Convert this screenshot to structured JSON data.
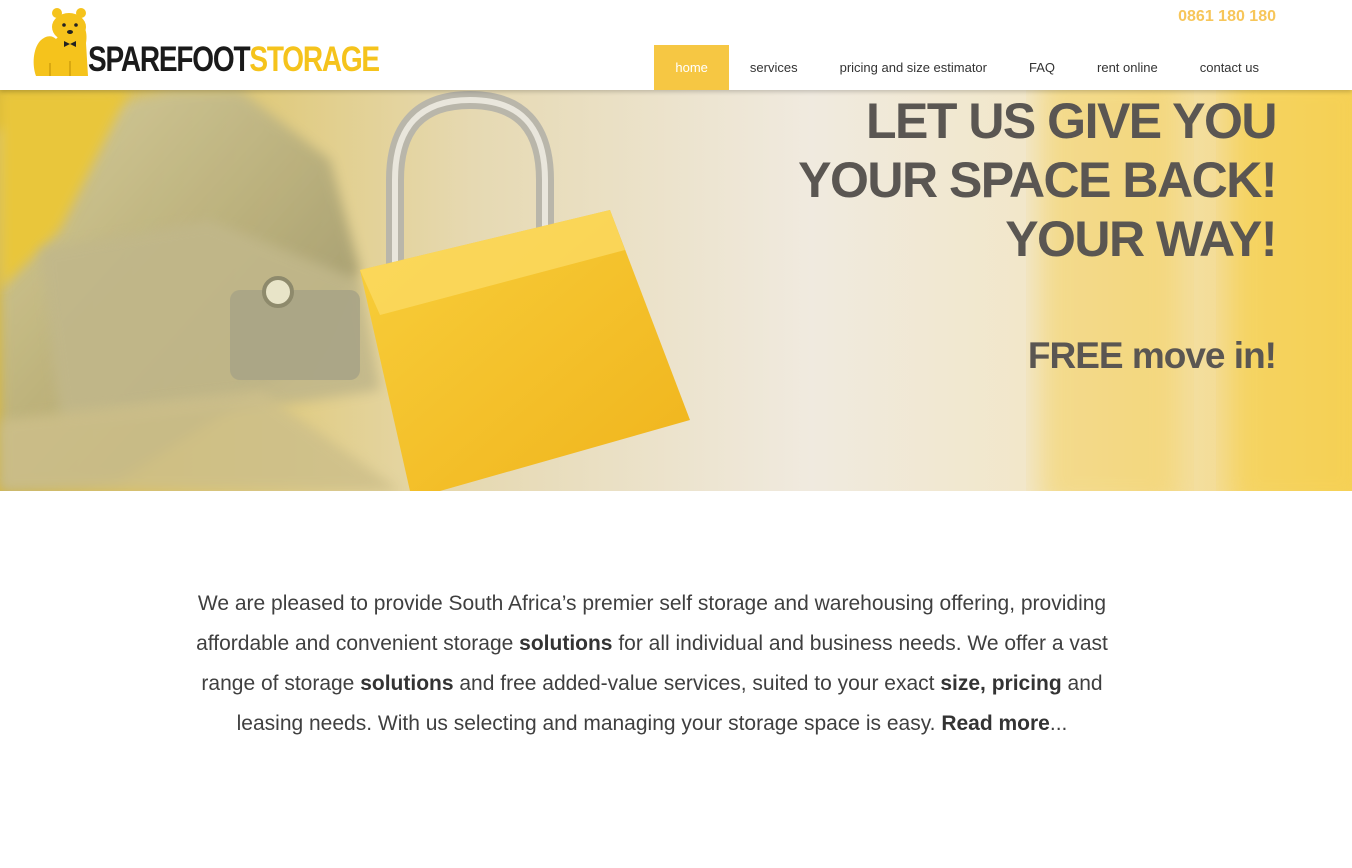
{
  "brand": {
    "logo_word1": "SPAREFOOT",
    "logo_word2": "STORAGE",
    "logo_icon": "bear-mascot-icon",
    "accent_color": "#f6c743",
    "phone_color": "#f7c65a"
  },
  "header": {
    "phone": "0861 180 180"
  },
  "nav": {
    "items": [
      {
        "label": "home",
        "active": true
      },
      {
        "label": "services",
        "active": false
      },
      {
        "label": "pricing and size estimator",
        "active": false
      },
      {
        "label": "FAQ",
        "active": false
      },
      {
        "label": "rent online",
        "active": false
      },
      {
        "label": "contact us",
        "active": false
      }
    ]
  },
  "hero": {
    "headline_lines": [
      "LET US GIVE YOU",
      "YOUR SPACE BACK!",
      "YOUR WAY!"
    ],
    "subheadline": "FREE move in!",
    "image": "yellow-padlock-on-latch"
  },
  "intro": {
    "segments": [
      "We are pleased to provide South Africa’s premier self storage and warehousing offering, providing affordable and convenient storage ",
      "solutions",
      " for all individual and business needs. We offer a vast range of storage ",
      "solutions",
      " and free added-value services, suited to your exact ",
      "size, pricing",
      " and leasing needs. With us selecting and managing your storage space is easy. ",
      "Read more",
      "..."
    ]
  }
}
